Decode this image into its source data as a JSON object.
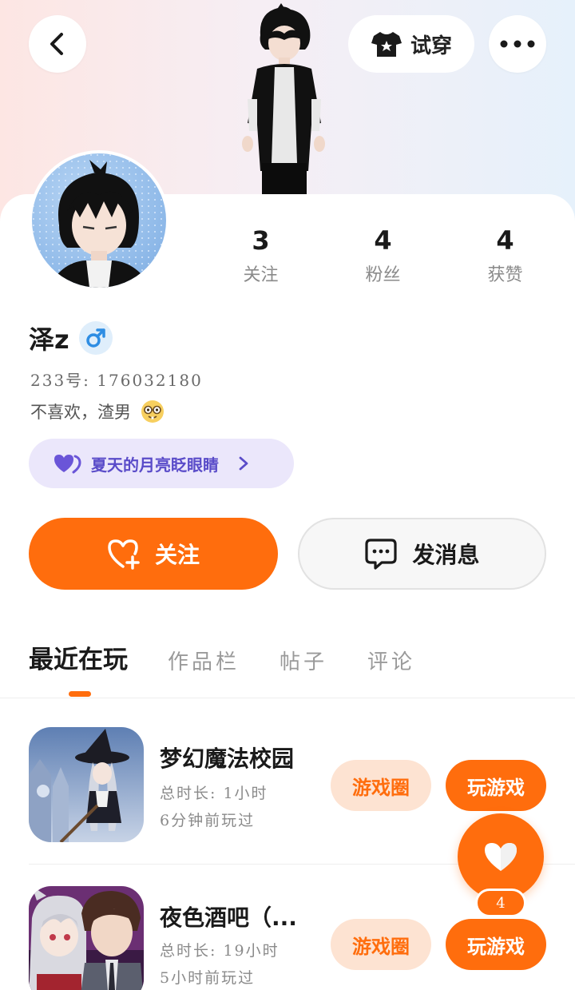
{
  "header": {
    "try_on_label": "试穿"
  },
  "profile": {
    "name": "泽z",
    "uid": "233号: 176032180",
    "bio": "不喜欢，渣男",
    "tag_label": "夏天的月亮眨眼睛"
  },
  "stats": [
    {
      "value": "3",
      "label": "关注"
    },
    {
      "value": "4",
      "label": "粉丝"
    },
    {
      "value": "4",
      "label": "获赞"
    }
  ],
  "actions": {
    "follow_label": "关注",
    "message_label": "发消息"
  },
  "tabs": [
    {
      "label": "最近在玩",
      "active": true
    },
    {
      "label": "作品栏",
      "active": false
    },
    {
      "label": "帖子",
      "active": false
    },
    {
      "label": "评论",
      "active": false
    }
  ],
  "games": [
    {
      "title": "梦幻魔法校园",
      "duration": "总时长: 1小时",
      "last_played": "6分钟前玩过",
      "circle_label": "游戏圈",
      "play_label": "玩游戏"
    },
    {
      "title": "夜色酒吧（...",
      "duration": "总时长: 19小时",
      "last_played": "5小时前玩过",
      "circle_label": "游戏圈",
      "play_label": "玩游戏"
    }
  ],
  "like_fab": {
    "count": "4"
  },
  "colors": {
    "accent": "#ff6d0d",
    "pill_bg": "#ebe7fb",
    "pill_text": "#5a4cc9",
    "gender_male": "#2e8de3"
  },
  "icons": {
    "back": "chevron-left-icon",
    "try_on": "tshirt-icon",
    "more": "more-dots-icon",
    "gender": "male-icon",
    "tag": "heart-icon",
    "follow": "heart-plus-icon",
    "message": "chat-bubble-icon",
    "like": "heart-icon"
  }
}
